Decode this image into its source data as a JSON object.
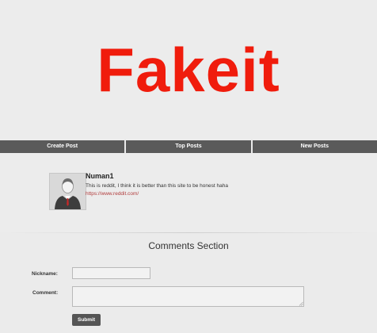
{
  "header": {
    "logo_text": "Fakeit",
    "logo_color": "#f01c0c"
  },
  "nav": {
    "items": [
      {
        "label": "Create Post"
      },
      {
        "label": "Top Posts"
      },
      {
        "label": "New Posts"
      }
    ]
  },
  "post": {
    "avatar_icon": "user-avatar-icon",
    "username": "Numan1",
    "text": "This is reddit, I think it is better than this site to be honest haha",
    "link": "https://www.reddit.com/"
  },
  "comments": {
    "title": "Comments Section",
    "nickname_label": "Nickname:",
    "nickname_value": "",
    "comment_label": "Comment:",
    "comment_value": "",
    "submit_label": "Submit"
  }
}
